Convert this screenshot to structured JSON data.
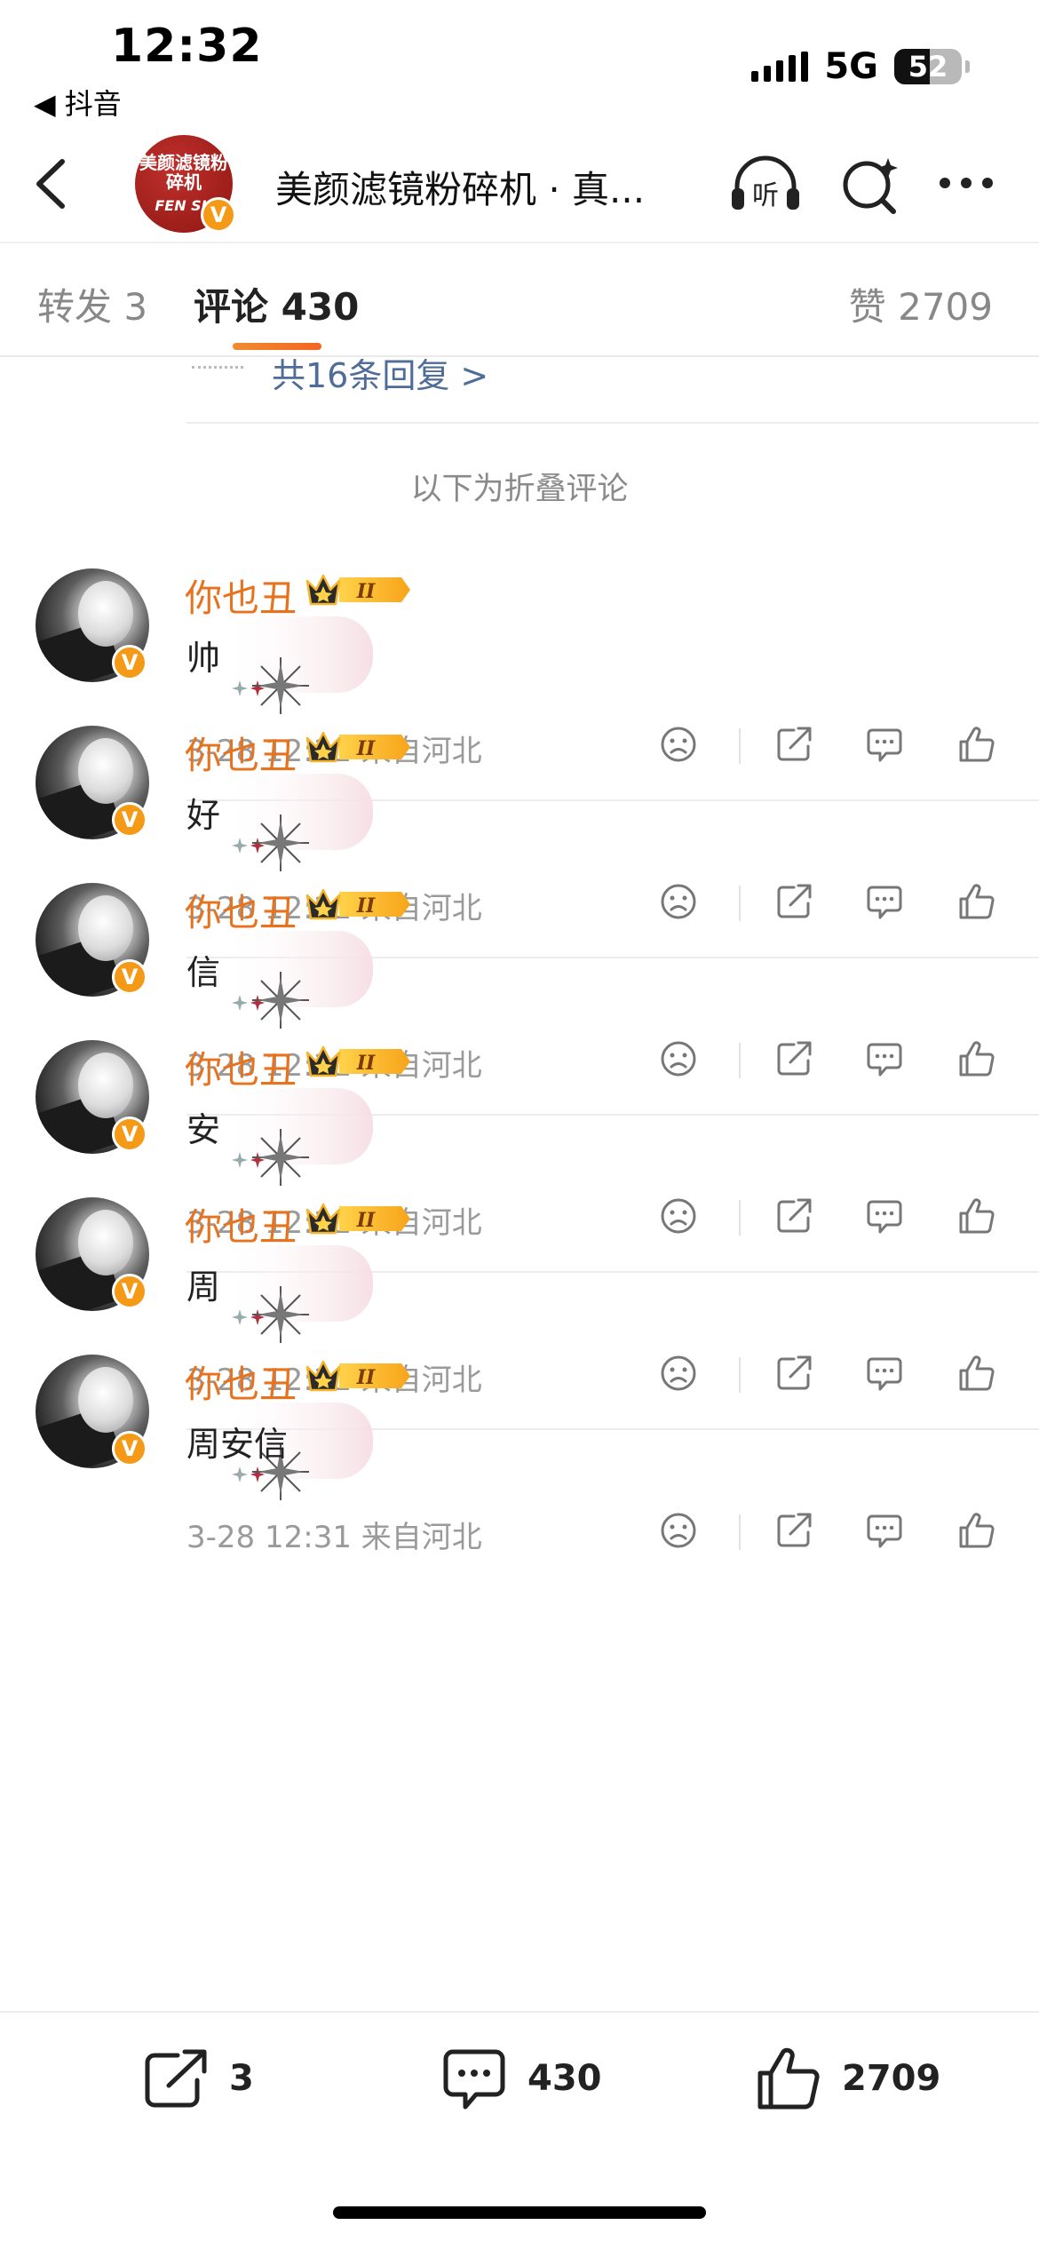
{
  "status_bar": {
    "time": "12:32",
    "back_app": "◀ 抖音",
    "network": "5G",
    "battery": "52",
    "battery_level": 0.52
  },
  "header": {
    "title": "美颜滤镜粉碎机 · 真...",
    "avatar_text_top": "美颜滤镜粉碎机",
    "avatar_text_bottom": "FEN SU",
    "verified_mark": "V",
    "icons": [
      "back-arrow-icon",
      "listen-headphones-icon",
      "search-sparkle-icon",
      "more-dots-icon"
    ],
    "listen_label": "听"
  },
  "tabs": {
    "repost": "转发 3",
    "comments": "评论 430",
    "likes": "赞 2709"
  },
  "replies_link": "共16条回复 >",
  "folded_label": "以下为折叠评论",
  "comments": [
    {
      "name": "你也丑",
      "badge": "II",
      "text": "帅",
      "meta": "3-28 12:31 来自河北"
    },
    {
      "name": "你也丑",
      "badge": "II",
      "text": "好",
      "meta": "3-28 12:31 来自河北"
    },
    {
      "name": "你也丑",
      "badge": "II",
      "text": "信",
      "meta": "3-28 12:31 来自河北"
    },
    {
      "name": "你也丑",
      "badge": "II",
      "text": "安",
      "meta": "3-28 12:31 来自河北"
    },
    {
      "name": "你也丑",
      "badge": "II",
      "text": "周",
      "meta": "3-28 12:31 来自河北"
    },
    {
      "name": "你也丑",
      "badge": "II",
      "text": "周安信",
      "meta": "3-28 12:31 来自河北"
    }
  ],
  "bottom_bar": {
    "repost_count": "3",
    "comment_count": "430",
    "like_count": "2709"
  },
  "colors": {
    "accent_orange": "#e8731f",
    "link_blue": "#506c98",
    "verified_orange": "#f59a16"
  }
}
